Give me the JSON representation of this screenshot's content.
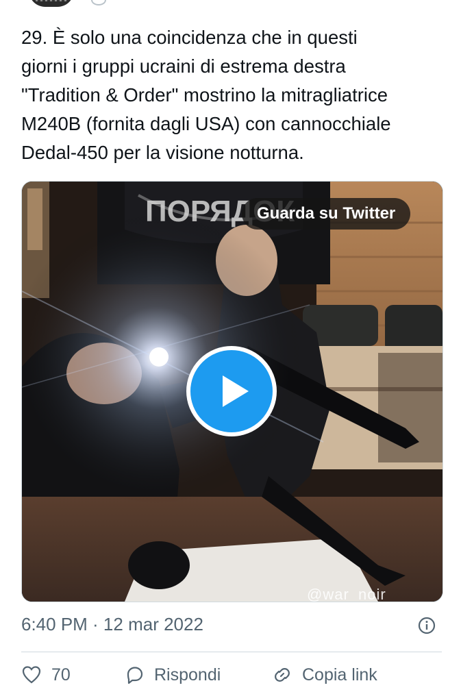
{
  "tweet": {
    "text": "29. È solo una coincidenza che in questi\ngiorni i gruppi ucraini di estrema destra\n\"Tradition & Order\" mostrino la mitragliatrice\nM240B (fornita dagli USA) con cannocchiale\nDedal-450 per la visione notturna.",
    "timestamp": "6:40 PM · 12 mar 2022"
  },
  "media": {
    "watch_label": "Guarda su Twitter",
    "watermark": "@war_noir",
    "banner_text": "ПОРЯДОК",
    "icons": {
      "play": "play-icon",
      "info": "info-icon"
    }
  },
  "actions": {
    "like_count": "70",
    "reply_label": "Rispondi",
    "copy_label": "Copia link"
  },
  "colors": {
    "accent": "#1d9bf0",
    "secondary_text": "#536471",
    "border": "#cfd9de"
  }
}
